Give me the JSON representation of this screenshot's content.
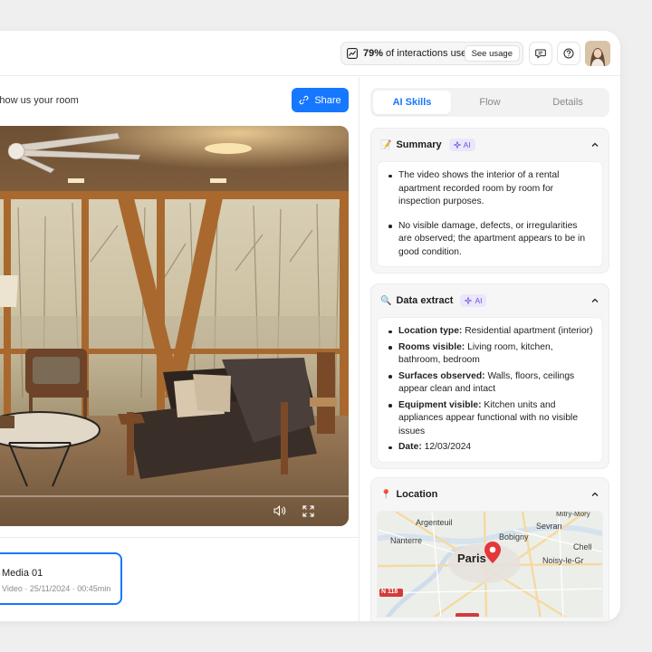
{
  "topbar": {
    "usage_percent": "79%",
    "usage_text": "of interactions used",
    "see_usage": "See usage",
    "icons": [
      "chart-icon",
      "chat-icon",
      "help-icon"
    ]
  },
  "left": {
    "title": "Show us your room",
    "share_label": "Share",
    "video": {
      "progress": 0.0,
      "icons": [
        "volume-icon",
        "fullscreen-icon"
      ]
    },
    "media": {
      "name": "Media 01",
      "meta": "Video · 25/11/2024 · 00:45min"
    }
  },
  "right": {
    "tabs": [
      {
        "label": "AI Skills",
        "active": true
      },
      {
        "label": "Flow",
        "active": false
      },
      {
        "label": "Details",
        "active": false
      }
    ],
    "summary": {
      "emoji": "📝",
      "title": "Summary",
      "badge": "AI",
      "items": [
        "The video shows the interior of a rental apartment recorded room by room for inspection purposes.",
        "No visible damage, defects, or irregularities are observed; the apartment appears to be in good condition."
      ]
    },
    "extract": {
      "emoji": "🔍",
      "title": "Data extract",
      "badge": "AI",
      "items": [
        {
          "key": "Location type:",
          "value": "Residential apartment (interior)"
        },
        {
          "key": "Rooms visible:",
          "value": "Living room, kitchen, bathroom, bedroom"
        },
        {
          "key": "Surfaces observed:",
          "value": "Walls, floors, ceilings appear clean and intact"
        },
        {
          "key": "Equipment visible:",
          "value": "Kitchen units and appliances appear functional with no visible issues"
        },
        {
          "key": "Date:",
          "value": "12/03/2024"
        }
      ]
    },
    "location": {
      "emoji": "📍",
      "title": "Location",
      "map_labels": {
        "argenteuil": "Argenteuil",
        "mitry": "Mitry-Mory",
        "sevran": "Sevran",
        "bobigny": "Bobigny",
        "nanterre": "Nanterre",
        "paris": "Paris",
        "chelles": "Chell",
        "noisy": "Noisy-le-Gr",
        "road": "N 118"
      }
    }
  },
  "colors": {
    "accent": "#1677ff",
    "ai_badge": "#6b52d6",
    "pin": "#e5373a"
  }
}
